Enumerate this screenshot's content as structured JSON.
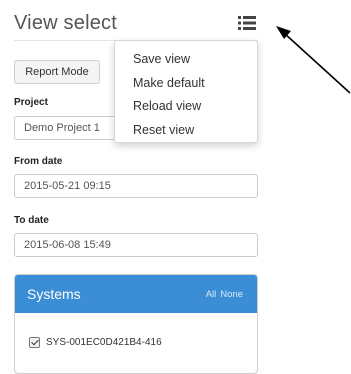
{
  "header": {
    "title": "View select",
    "menu_icon": "list-icon"
  },
  "menu": {
    "items": [
      {
        "label": "Save view"
      },
      {
        "label": "Make default"
      },
      {
        "label": "Reload view"
      },
      {
        "label": "Reset view"
      }
    ]
  },
  "mode_button": {
    "label": "Report Mode"
  },
  "project": {
    "label": "Project",
    "value": "Demo Project 1"
  },
  "from_date": {
    "label": "From date",
    "value": "2015-05-21 09:15"
  },
  "to_date": {
    "label": "To date",
    "value": "2015-06-08 15:49"
  },
  "systems": {
    "title": "Systems",
    "all_label": "All",
    "none_label": "None",
    "items": [
      {
        "label": "SYS-001EC0D421B4-416",
        "checked": true
      }
    ]
  },
  "colors": {
    "panel_header": "#3b8ed6",
    "annotation_arrow": "#000000"
  }
}
